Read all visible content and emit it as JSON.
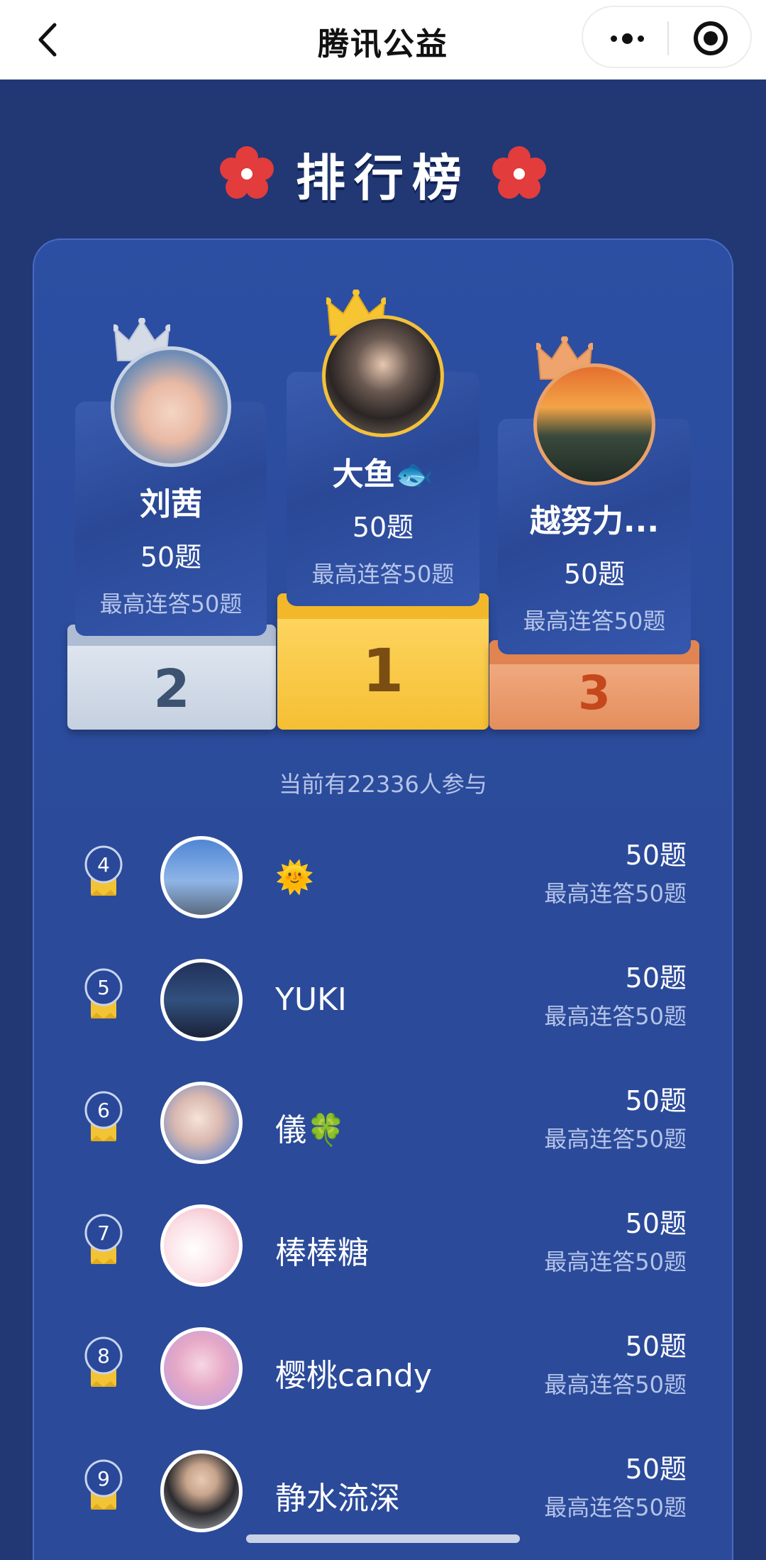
{
  "nav": {
    "title": "腾讯公益"
  },
  "leaderboard": {
    "title": "排行榜"
  },
  "podium": {
    "first": {
      "rank": "1",
      "name": "大鱼",
      "name_emoji": "🐟",
      "count": "50题",
      "streak": "最高连答50题"
    },
    "second": {
      "rank": "2",
      "name": "刘茜",
      "count": "50题",
      "streak": "最高连答50题"
    },
    "third": {
      "rank": "3",
      "name": "越努力...",
      "count": "50题",
      "streak": "最高连答50题"
    }
  },
  "participants": "当前有22336人参与",
  "list": [
    {
      "rank": "4",
      "name": "🌞",
      "count": "50题",
      "streak": "最高连答50题"
    },
    {
      "rank": "5",
      "name": "YUKI",
      "count": "50题",
      "streak": "最高连答50题"
    },
    {
      "rank": "6",
      "name": "儀🍀",
      "count": "50题",
      "streak": "最高连答50题"
    },
    {
      "rank": "7",
      "name": "棒棒糖",
      "count": "50题",
      "streak": "最高连答50题"
    },
    {
      "rank": "8",
      "name": "樱桃candy",
      "count": "50题",
      "streak": "最高连答50题"
    },
    {
      "rank": "9",
      "name": "静水流深",
      "count": "50题",
      "streak": "最高连答50题"
    }
  ],
  "colors": {
    "background": "#213874",
    "card": "#2c4fa3",
    "gold": "#f6c63d",
    "silver": "#c8d2e2",
    "bronze": "#e7986a",
    "flower": "#e23c3c"
  }
}
